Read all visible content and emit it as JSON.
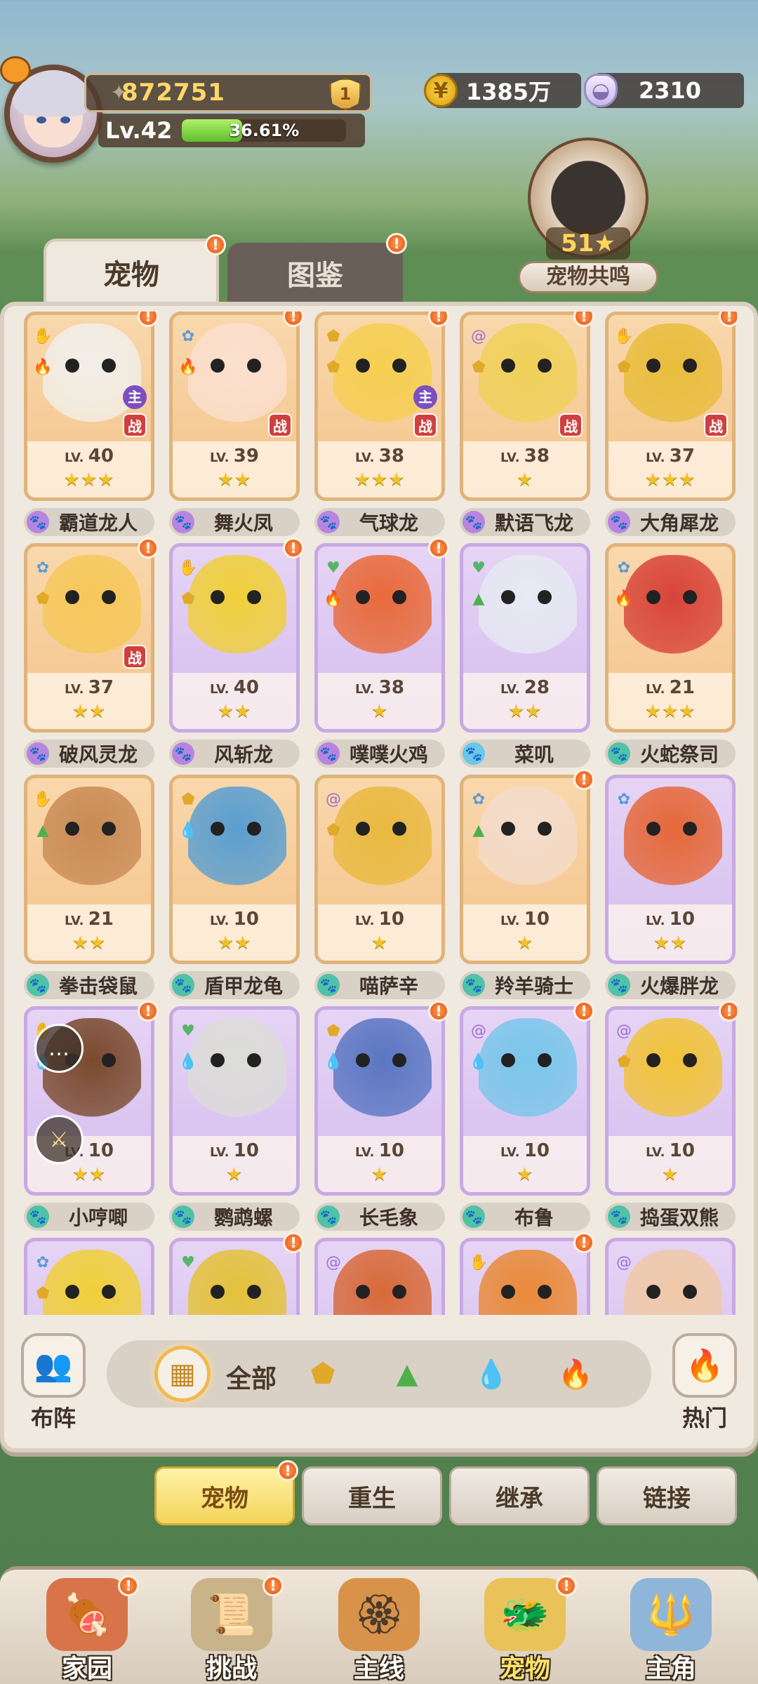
{
  "player": {
    "power": "872751",
    "rank": "1",
    "level": "Lv.42",
    "exp_percent": "36.61%",
    "exp_fraction": 0.3661
  },
  "currency": {
    "gold": "1385万",
    "shells": "2310"
  },
  "resonance": {
    "stars": "51★",
    "label": "宠物共鸣"
  },
  "tabs": {
    "pets": "宠物",
    "atlas": "图鉴"
  },
  "pets": [
    {
      "name": "霸道龙人",
      "lv": "40",
      "stars": "★★★",
      "frame": "orange",
      "paw": "purple",
      "color": "#f2efe9",
      "types": [
        "claw",
        "fire"
      ],
      "zhu": true,
      "zhan": true,
      "dot": true
    },
    {
      "name": "舞火凤",
      "lv": "39",
      "stars": "★★",
      "frame": "orange",
      "paw": "purple",
      "color": "#fbe0cf",
      "types": [
        "gear",
        "fire"
      ],
      "zhu": false,
      "zhan": true,
      "dot": true
    },
    {
      "name": "气球龙",
      "lv": "38",
      "stars": "★★★",
      "frame": "orange",
      "paw": "purple",
      "color": "#f6cf52",
      "types": [
        "shield",
        "shield"
      ],
      "zhu": true,
      "zhan": true,
      "dot": true
    },
    {
      "name": "默语飞龙",
      "lv": "38",
      "stars": "★",
      "frame": "orange",
      "paw": "purple",
      "color": "#f0d15a",
      "types": [
        "spiral",
        "shield"
      ],
      "zhu": false,
      "zhan": true,
      "dot": true
    },
    {
      "name": "大角犀龙",
      "lv": "37",
      "stars": "★★★",
      "frame": "orange",
      "paw": "purple",
      "color": "#e9bd3c",
      "types": [
        "claw",
        "shield"
      ],
      "zhu": false,
      "zhan": true,
      "dot": true
    },
    {
      "name": "破风灵龙",
      "lv": "37",
      "stars": "★★",
      "frame": "orange",
      "paw": "purple",
      "color": "#f6c85a",
      "types": [
        "gear",
        "shield"
      ],
      "zhu": false,
      "zhan": true,
      "dot": true
    },
    {
      "name": "风斩龙",
      "lv": "40",
      "stars": "★★",
      "frame": "purple",
      "paw": "purple",
      "color": "#f0cf3a",
      "types": [
        "claw",
        "shield"
      ],
      "zhu": false,
      "zhan": false,
      "dot": true
    },
    {
      "name": "噗噗火鸡",
      "lv": "38",
      "stars": "★",
      "frame": "purple",
      "paw": "purple",
      "color": "#e86a3a",
      "types": [
        "heart",
        "fire"
      ],
      "zhu": false,
      "zhan": false,
      "dot": true
    },
    {
      "name": "菜叽",
      "lv": "28",
      "stars": "★★",
      "frame": "purple",
      "paw": "blue",
      "color": "#e7e9f3",
      "types": [
        "heart",
        "leaf"
      ],
      "zhu": false,
      "zhan": false,
      "dot": false
    },
    {
      "name": "火蛇祭司",
      "lv": "21",
      "stars": "★★★",
      "frame": "orange",
      "paw": "teal",
      "color": "#d8443a",
      "types": [
        "gear",
        "fire"
      ],
      "zhu": false,
      "zhan": false,
      "dot": false
    },
    {
      "name": "拳击袋鼠",
      "lv": "21",
      "stars": "★★",
      "frame": "orange",
      "paw": "teal",
      "color": "#c98a55",
      "types": [
        "claw",
        "leaf"
      ],
      "zhu": false,
      "zhan": false,
      "dot": false
    },
    {
      "name": "盾甲龙龟",
      "lv": "10",
      "stars": "★★",
      "frame": "orange",
      "paw": "teal",
      "color": "#5a9fd0",
      "types": [
        "shield",
        "drop"
      ],
      "zhu": false,
      "zhan": false,
      "dot": false
    },
    {
      "name": "喵萨辛",
      "lv": "10",
      "stars": "★",
      "frame": "orange",
      "paw": "teal",
      "color": "#e9b940",
      "types": [
        "spiral",
        "shield"
      ],
      "zhu": false,
      "zhan": false,
      "dot": false
    },
    {
      "name": "羚羊骑士",
      "lv": "10",
      "stars": "★",
      "frame": "orange",
      "paw": "teal",
      "color": "#f4dccb",
      "types": [
        "gear",
        "leaf"
      ],
      "zhu": false,
      "zhan": false,
      "dot": true
    },
    {
      "name": "火爆胖龙",
      "lv": "10",
      "stars": "★★",
      "frame": "purple",
      "paw": "teal",
      "color": "#e5683a",
      "types": [
        "gear"
      ],
      "zhu": false,
      "zhan": false,
      "dot": false
    },
    {
      "name": "小哼唧",
      "lv": "10",
      "stars": "★★",
      "frame": "purple",
      "paw": "teal",
      "color": "#7a4a2e",
      "types": [
        "claw",
        "drop"
      ],
      "zhu": false,
      "zhan": false,
      "dot": true,
      "overlay": true
    },
    {
      "name": "鹦鹉螺",
      "lv": "10",
      "stars": "★",
      "frame": "purple",
      "paw": "teal",
      "color": "#dcdcd8",
      "types": [
        "heart",
        "drop"
      ],
      "zhu": false,
      "zhan": false,
      "dot": false
    },
    {
      "name": "长毛象",
      "lv": "10",
      "stars": "★",
      "frame": "purple",
      "paw": "teal",
      "color": "#5a76c2",
      "types": [
        "shield",
        "drop"
      ],
      "zhu": false,
      "zhan": false,
      "dot": true
    },
    {
      "name": "布鲁",
      "lv": "10",
      "stars": "★",
      "frame": "purple",
      "paw": "teal",
      "color": "#79c6ea",
      "types": [
        "spiral",
        "drop"
      ],
      "zhu": false,
      "zhan": false,
      "dot": true
    },
    {
      "name": "捣蛋双熊",
      "lv": "10",
      "stars": "★",
      "frame": "purple",
      "paw": "teal",
      "color": "#f1c33a",
      "types": [
        "spiral",
        "shield"
      ],
      "zhu": false,
      "zhan": false,
      "dot": true
    },
    {
      "name": "",
      "lv": "",
      "stars": "",
      "frame": "purple",
      "paw": "teal",
      "color": "#f0cf3a",
      "types": [
        "gear",
        "shield"
      ],
      "zhu": false,
      "zhan": false,
      "dot": false
    },
    {
      "name": "",
      "lv": "",
      "stars": "",
      "frame": "purple",
      "paw": "teal",
      "color": "#e4c23a",
      "types": [
        "heart"
      ],
      "zhu": false,
      "zhan": false,
      "dot": true
    },
    {
      "name": "",
      "lv": "",
      "stars": "",
      "frame": "purple",
      "paw": "teal",
      "color": "#d86a3a",
      "types": [
        "spiral"
      ],
      "zhu": false,
      "zhan": false,
      "dot": false
    },
    {
      "name": "",
      "lv": "",
      "stars": "",
      "frame": "purple",
      "paw": "teal",
      "color": "#e98a3a",
      "types": [
        "claw"
      ],
      "zhu": false,
      "zhan": false,
      "dot": true
    },
    {
      "name": "",
      "lv": "",
      "stars": "",
      "frame": "purple",
      "paw": "teal",
      "color": "#f0c9a8",
      "types": [
        "spiral"
      ],
      "zhu": false,
      "zhan": false,
      "dot": false
    }
  ],
  "filter": {
    "all_label": "全部",
    "types": [
      "shield-icon",
      "leaf-icon",
      "drop-icon",
      "fire-icon"
    ]
  },
  "side": {
    "formation": "布阵",
    "hot": "热门"
  },
  "subtabs": [
    "宠物",
    "重生",
    "继承",
    "链接"
  ],
  "nav": [
    {
      "label": "家园",
      "icon": "meat-icon",
      "dot": true
    },
    {
      "label": "挑战",
      "icon": "scroll-icon",
      "dot": true
    },
    {
      "label": "主线",
      "icon": "medal-icon",
      "dot": false
    },
    {
      "label": "宠物",
      "icon": "dragon-icon",
      "dot": true,
      "active": true
    },
    {
      "label": "主角",
      "icon": "staff-icon",
      "dot": false
    }
  ],
  "colors": {
    "accent": "#f3d45a",
    "dot": "#e2501a",
    "card_orange": "#f4c48a",
    "card_purple": "#d4bdee"
  }
}
